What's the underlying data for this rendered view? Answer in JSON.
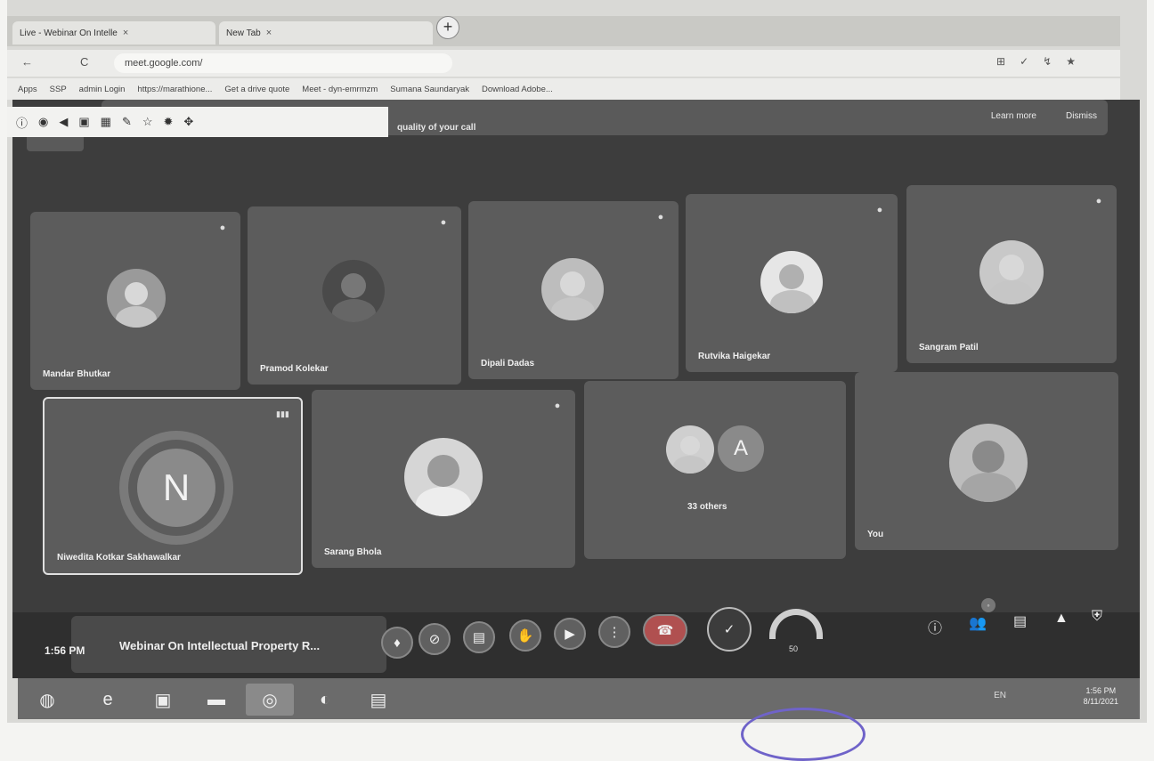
{
  "browser": {
    "tabs": [
      {
        "label": "Live - Webinar On Intelle",
        "close": "×"
      },
      {
        "label": "New Tab",
        "close": "×"
      }
    ],
    "new_tab": "+",
    "url": "meet.google.com/",
    "nav": {
      "back": "←",
      "reload": "C"
    },
    "bookmarks": [
      "Apps",
      "SSP",
      "admin Login",
      "https://marathione...",
      "Get a drive quote",
      "Meet - dyn-emrmzm",
      "Sumana Saundaryak",
      "Download Adobe..."
    ],
    "extensions": [
      "⊞",
      "✓",
      "↯",
      "★"
    ]
  },
  "meet": {
    "banner": {
      "text": "quality of your call",
      "learn_more": "Learn more",
      "dismiss": "Dismiss"
    },
    "participants": [
      {
        "name": "Mandar Bhutkar"
      },
      {
        "name": "Pramod Kolekar"
      },
      {
        "name": "Dipali Dadas"
      },
      {
        "name": "Rutvika Haigekar"
      },
      {
        "name": "Sangram Patil"
      },
      {
        "name": "Niwedita Kotkar Sakhawalkar",
        "initial": "N"
      },
      {
        "name": "Sarang Bhola"
      },
      {
        "name": "",
        "others": "33 others",
        "initial": "A"
      },
      {
        "name": "You"
      }
    ],
    "time": "1:56 PM",
    "meeting_title": "Webinar On Intellectual Property R...",
    "gauge_value": "50"
  },
  "taskbar": {
    "clock_time": "1:56 PM",
    "clock_date": "8/11/2021",
    "tray": "EN"
  },
  "colors": {
    "stage": "#3d3d3d",
    "tile": "#5c5c5c",
    "end_call": "#b05050",
    "stamp": "#6f63c9"
  }
}
